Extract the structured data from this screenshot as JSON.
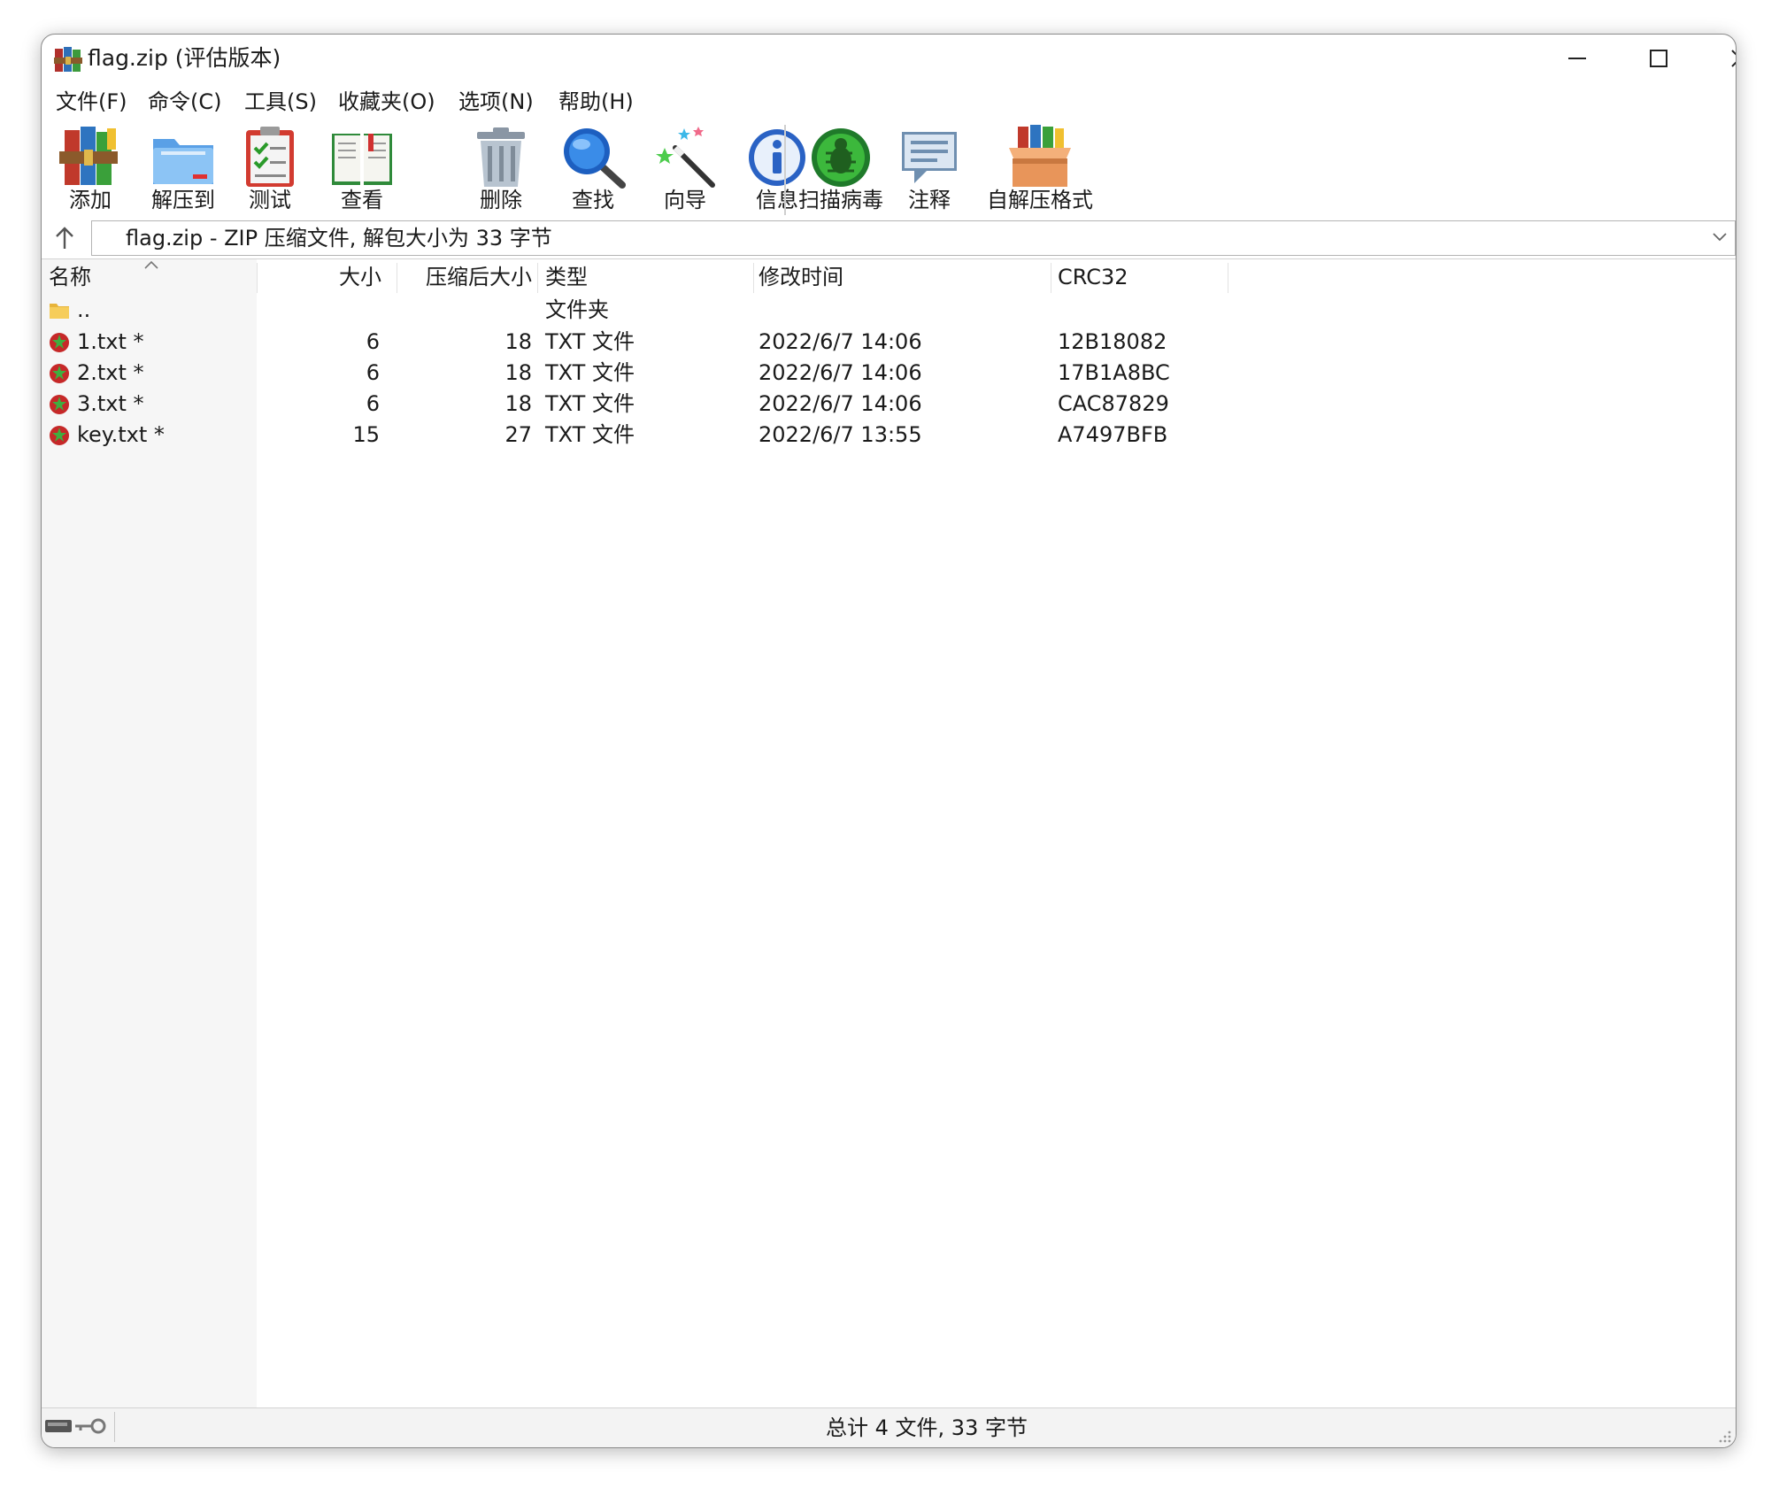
{
  "window": {
    "title": "flag.zip (评估版本)"
  },
  "menu": [
    {
      "label": "文件(F)"
    },
    {
      "label": "命令(C)"
    },
    {
      "label": "工具(S)"
    },
    {
      "label": "收藏夹(O)"
    },
    {
      "label": "选项(N)"
    },
    {
      "label": "帮助(H)"
    }
  ],
  "toolbar": [
    {
      "label": "添加",
      "icon": "add-archive-icon"
    },
    {
      "label": "解压到",
      "icon": "extract-folder-icon"
    },
    {
      "label": "测试",
      "icon": "test-clipboard-icon"
    },
    {
      "label": "查看",
      "icon": "view-book-icon"
    },
    {
      "label": "删除",
      "icon": "trash-icon"
    },
    {
      "label": "查找",
      "icon": "magnifier-icon"
    },
    {
      "label": "向导",
      "icon": "wizard-wand-icon"
    },
    {
      "label": "信息",
      "icon": "info-icon"
    },
    {
      "label": "扫描病毒",
      "icon": "virus-scan-icon"
    },
    {
      "label": "注释",
      "icon": "comment-icon"
    },
    {
      "label": "自解压格式",
      "icon": "sfx-box-icon"
    }
  ],
  "address": {
    "text": "flag.zip - ZIP 压缩文件, 解包大小为 33 字节"
  },
  "columns": {
    "name": "名称",
    "size": "大小",
    "packed": "压缩后大小",
    "type": "类型",
    "modified": "修改时间",
    "crc": "CRC32"
  },
  "rows": [
    {
      "name": "..",
      "size": "",
      "packed": "",
      "type": "文件夹",
      "modified": "",
      "crc": "",
      "icon": "folder-icon"
    },
    {
      "name": "1.txt *",
      "size": "6",
      "packed": "18",
      "type": "TXT 文件",
      "modified": "2022/6/7 14:06",
      "crc": "12B18082",
      "icon": "encrypted-file-icon"
    },
    {
      "name": "2.txt *",
      "size": "6",
      "packed": "18",
      "type": "TXT 文件",
      "modified": "2022/6/7 14:06",
      "crc": "17B1A8BC",
      "icon": "encrypted-file-icon"
    },
    {
      "name": "3.txt *",
      "size": "6",
      "packed": "18",
      "type": "TXT 文件",
      "modified": "2022/6/7 14:06",
      "crc": "CAC87829",
      "icon": "encrypted-file-icon"
    },
    {
      "name": "key.txt *",
      "size": "15",
      "packed": "27",
      "type": "TXT 文件",
      "modified": "2022/6/7 13:55",
      "crc": "A7497BFB",
      "icon": "encrypted-file-icon"
    }
  ],
  "status": {
    "text": "总计 4 文件, 33 字节"
  }
}
